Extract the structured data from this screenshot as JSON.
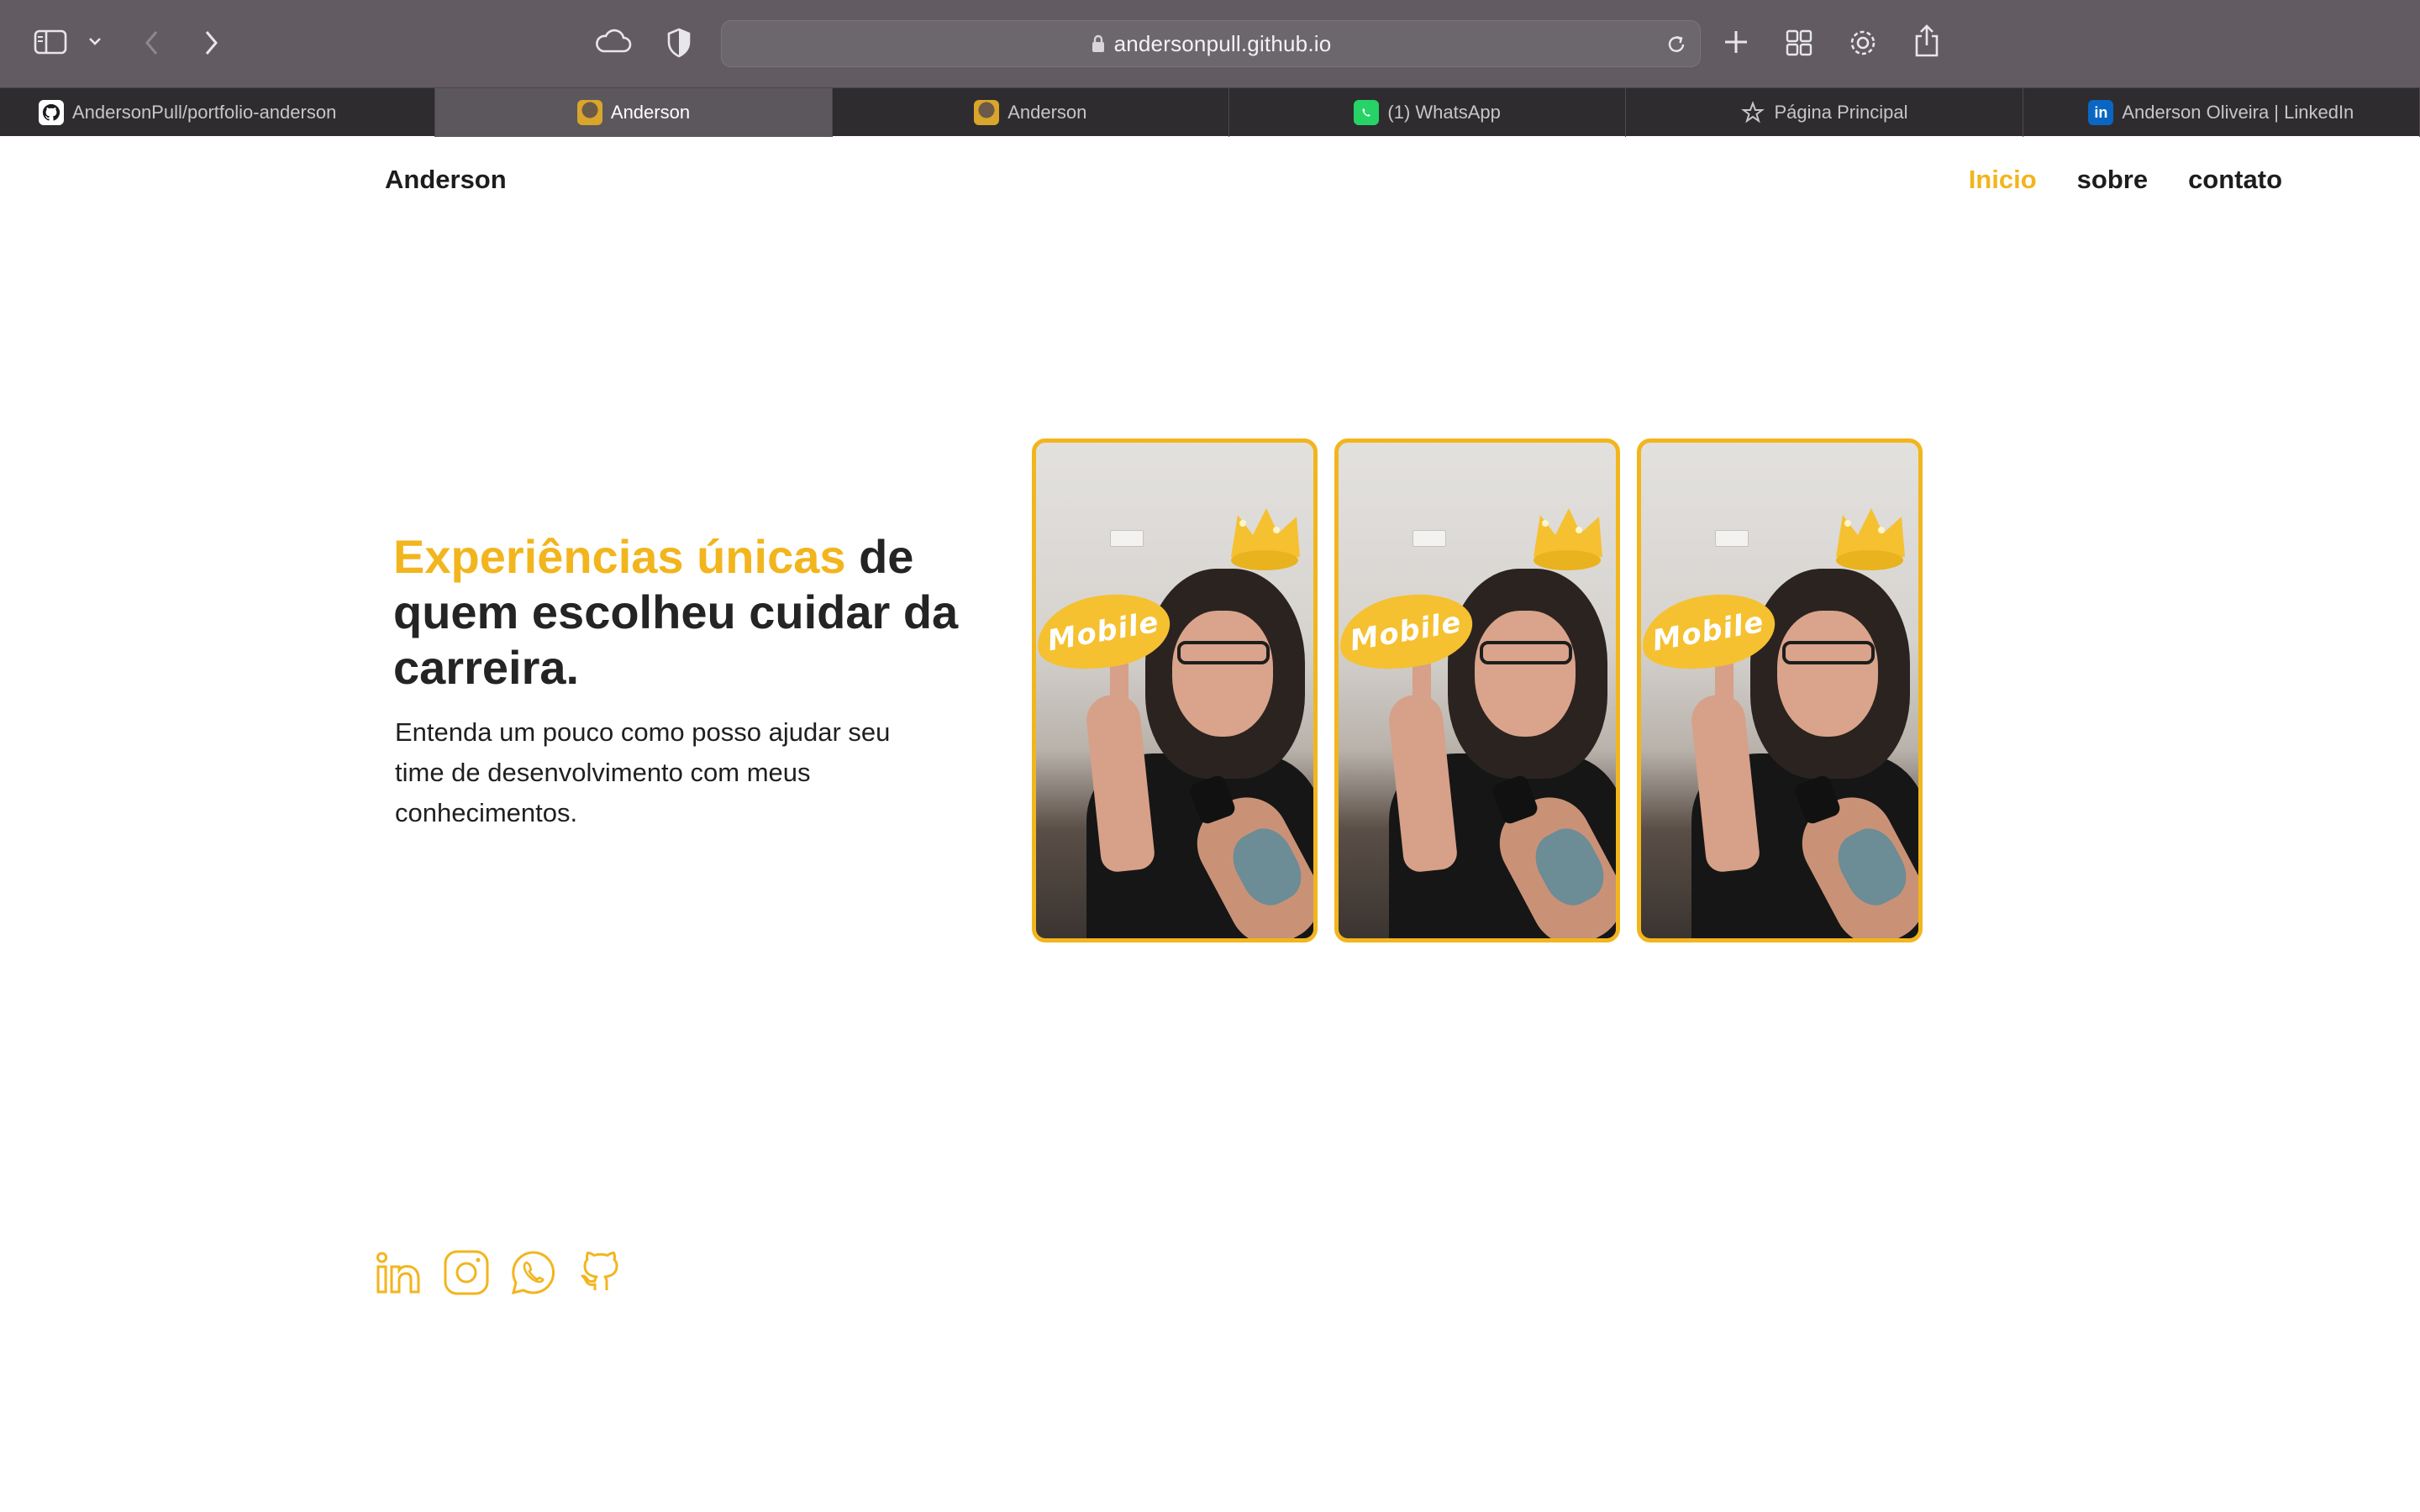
{
  "browser": {
    "url": "andersonpull.github.io",
    "tabs": [
      {
        "label": "AndersonPull/portfolio-anderson",
        "favicon": "github-icon",
        "active": false
      },
      {
        "label": "Anderson",
        "favicon": "avatar-icon",
        "active": true
      },
      {
        "label": "Anderson",
        "favicon": "avatar-icon",
        "active": false
      },
      {
        "label": "(1) WhatsApp",
        "favicon": "whatsapp-icon",
        "active": false
      },
      {
        "label": "Página Principal",
        "favicon": "star-icon",
        "active": false
      },
      {
        "label": "Anderson Oliveira | LinkedIn",
        "favicon": "linkedin-icon",
        "active": false
      }
    ],
    "toolbar_icons": [
      "sidebar-icon",
      "chevron-down-icon",
      "back-icon",
      "forward-icon",
      "icloud-icon",
      "privacy-shield-icon",
      "lock-icon",
      "reload-icon",
      "new-tab-icon",
      "tab-overview-icon",
      "settings-icon",
      "share-icon"
    ]
  },
  "page": {
    "brand": "Anderson",
    "nav": [
      {
        "label": "Inicio",
        "active": true
      },
      {
        "label": "sobre",
        "active": false
      },
      {
        "label": "contato",
        "active": false
      }
    ],
    "hero": {
      "title_highlight": "Experiências únicas",
      "title_rest": " de quem escolheu cuidar da carreira.",
      "subtitle": "Entenda um pouco como posso ajudar seu time de desenvolvimento com meus conhecimentos."
    },
    "photos": [
      {
        "sticker": "Mobile"
      },
      {
        "sticker": "Mobile"
      },
      {
        "sticker": "Mobile"
      }
    ],
    "socials": [
      "linkedin-icon",
      "instagram-icon",
      "whatsapp-icon",
      "github-icon"
    ]
  },
  "colors": {
    "accent": "#f2b51d",
    "text": "#1d1d1f",
    "toolbar": "#625c62",
    "tabbar": "#2f2c30"
  }
}
